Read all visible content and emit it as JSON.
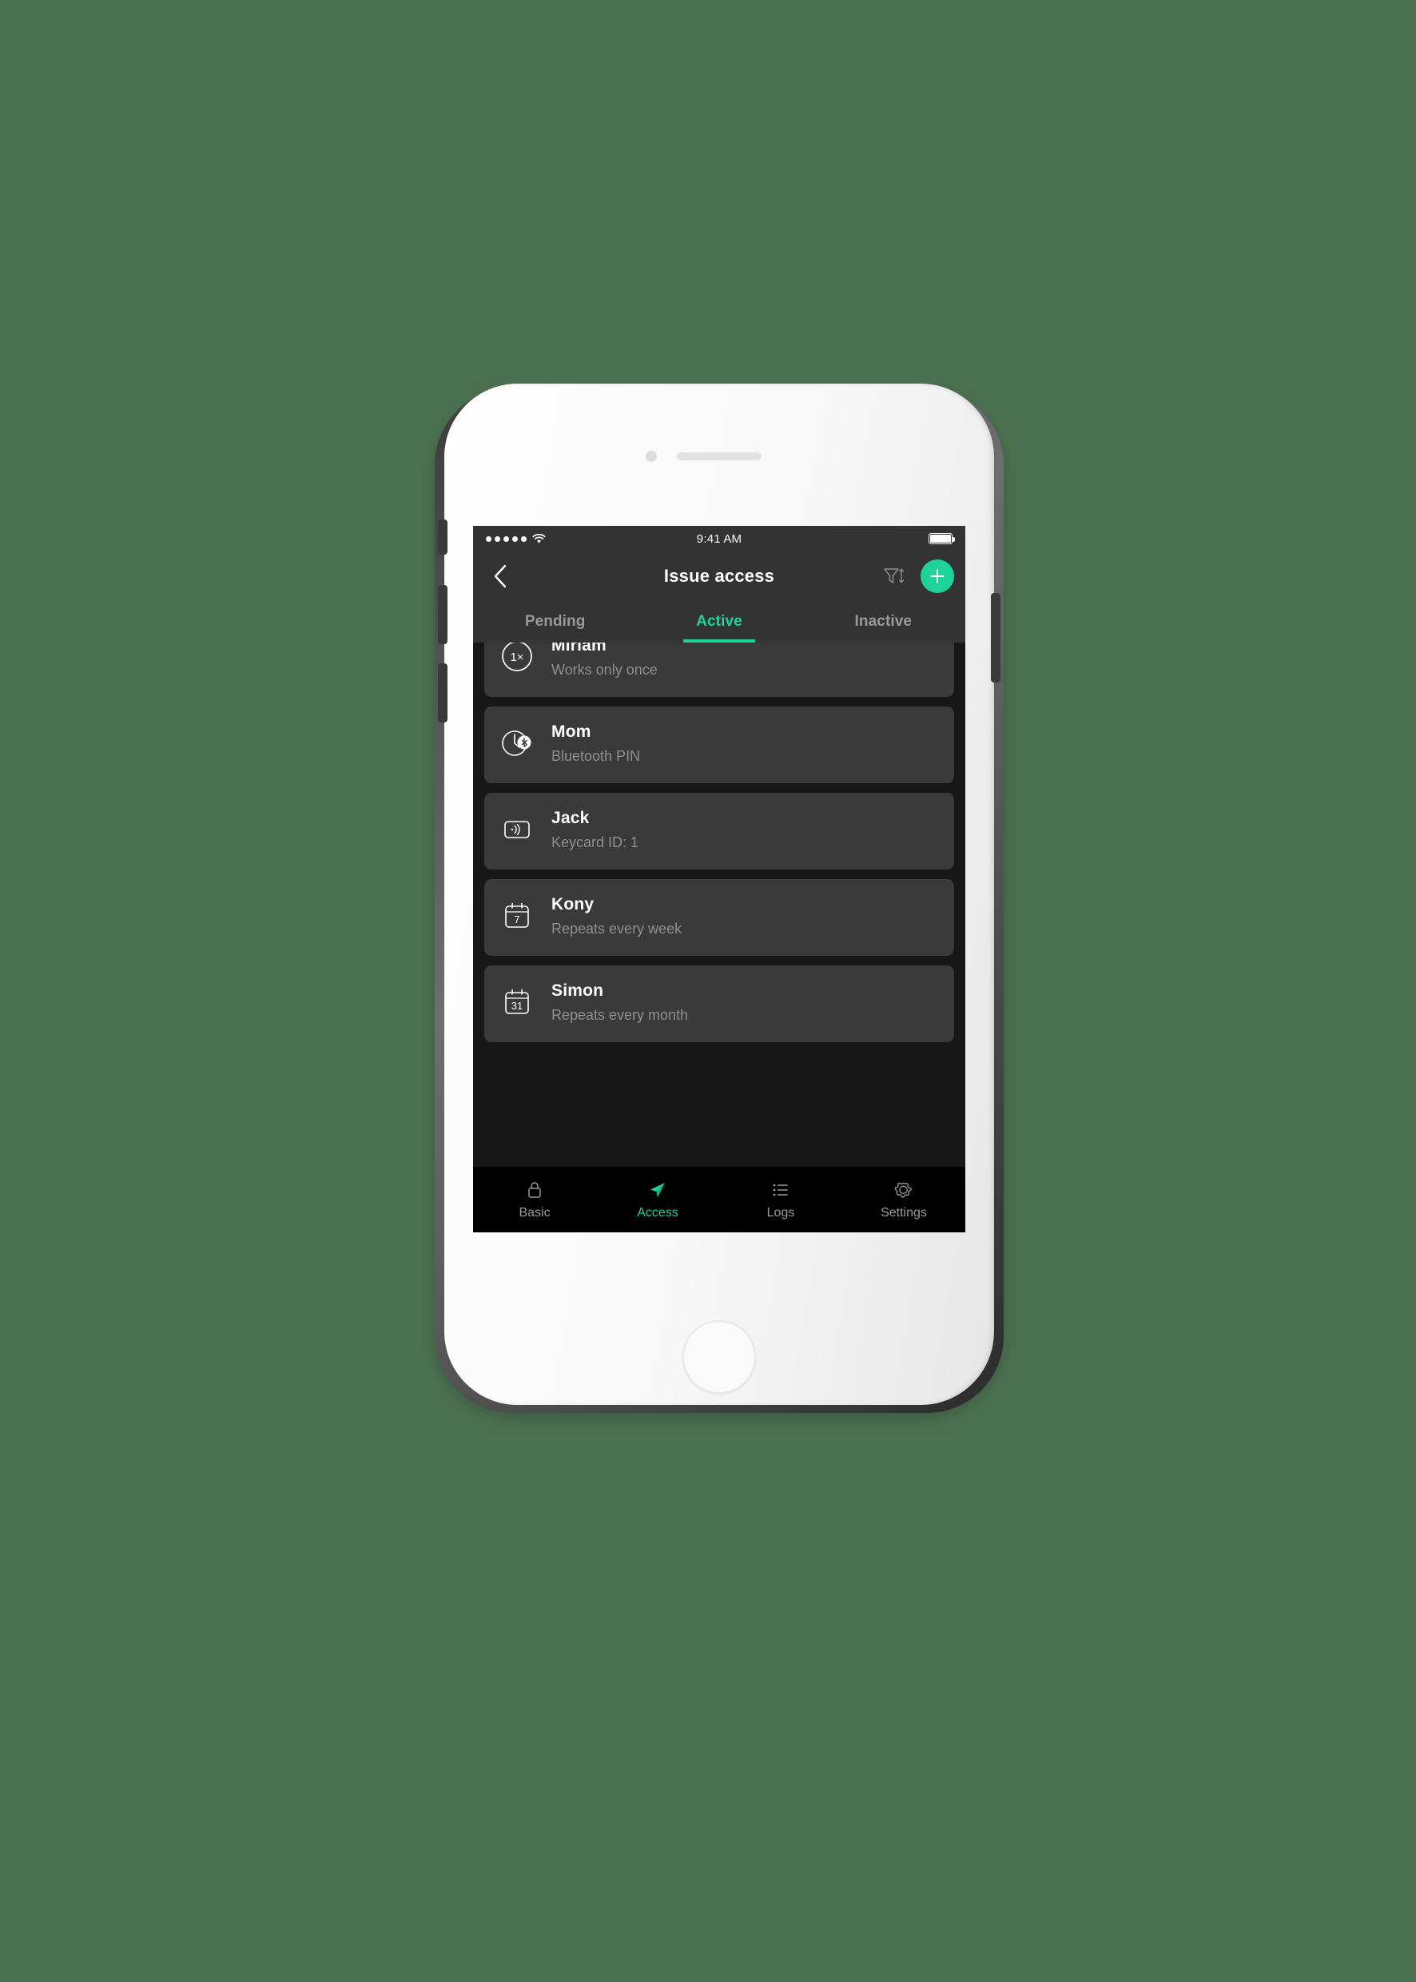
{
  "background_color": "#4c7251",
  "accent_color": "#1ed39a",
  "status_bar": {
    "signal_icon": "signal-dots-icon",
    "wifi_icon": "wifi-icon",
    "time": "9:41 AM",
    "battery_icon": "battery-full-icon"
  },
  "nav": {
    "back_icon": "chevron-left-icon",
    "title": "Issue access",
    "filter_icon": "filter-sort-icon",
    "add_label": "+"
  },
  "tabs": [
    {
      "label": "Pending",
      "active": false
    },
    {
      "label": "Active",
      "active": true
    },
    {
      "label": "Inactive",
      "active": false
    }
  ],
  "list": [
    {
      "icon": "once-1x-icon",
      "title": "Miriam",
      "subtitle": "Works only once"
    },
    {
      "icon": "clock-bluetooth-icon",
      "title": "Mom",
      "subtitle": "Bluetooth PIN"
    },
    {
      "icon": "keycard-nfc-icon",
      "title": "Jack",
      "subtitle": "Keycard ID: 1"
    },
    {
      "icon": "calendar-7-icon",
      "title": "Kony",
      "subtitle": "Repeats every week"
    },
    {
      "icon": "calendar-31-icon",
      "title": "Simon",
      "subtitle": "Repeats every month"
    }
  ],
  "icon_labels": {
    "once": "1×",
    "week_day": "7",
    "month_day": "31"
  },
  "tab_bar": [
    {
      "label": "Basic",
      "icon": "lock-icon",
      "active": false
    },
    {
      "label": "Access",
      "icon": "paper-plane-icon",
      "active": true
    },
    {
      "label": "Logs",
      "icon": "list-icon",
      "active": false
    },
    {
      "label": "Settings",
      "icon": "gear-icon",
      "active": false
    }
  ]
}
